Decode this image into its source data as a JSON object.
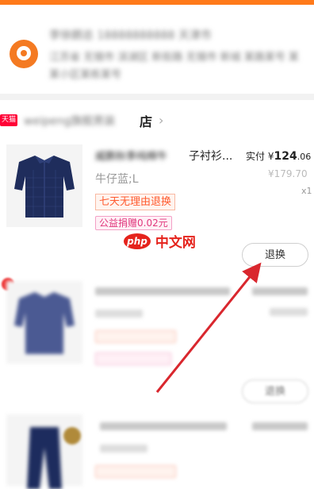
{
  "address": {
    "line1": "李徐朗总 18888888888 天津市",
    "line2": "江苏省 无锡市 滨湖区 新街路 无锡市 新城 某路某号 某某小区某栋某号"
  },
  "shop": {
    "badge": "天猫",
    "name_blurred": "weipeng旗舰男装",
    "name_visible": "店",
    "chevron": "›"
  },
  "items": [
    {
      "title_blurred": "威鹏秋季纯棉牛",
      "title_visible": "子衬衫...",
      "paid_label": "实付",
      "currency": "¥",
      "paid_int": "124",
      "paid_dec": ".06",
      "original_price": "¥179.70",
      "sku": "牛仔蓝;L",
      "qty": "x1",
      "tag_return": "七天无理由退换",
      "tag_charity": "公益捐赠0.02元",
      "action": "退换"
    },
    {
      "action": "退换"
    }
  ],
  "watermark": {
    "logo": "php",
    "text": "中文网"
  },
  "colors": {
    "accent_orange": "#ff7a1a",
    "return_tag": "#ff5a2e",
    "charity_tag": "#e0387d",
    "arrow": "#d9272e"
  }
}
